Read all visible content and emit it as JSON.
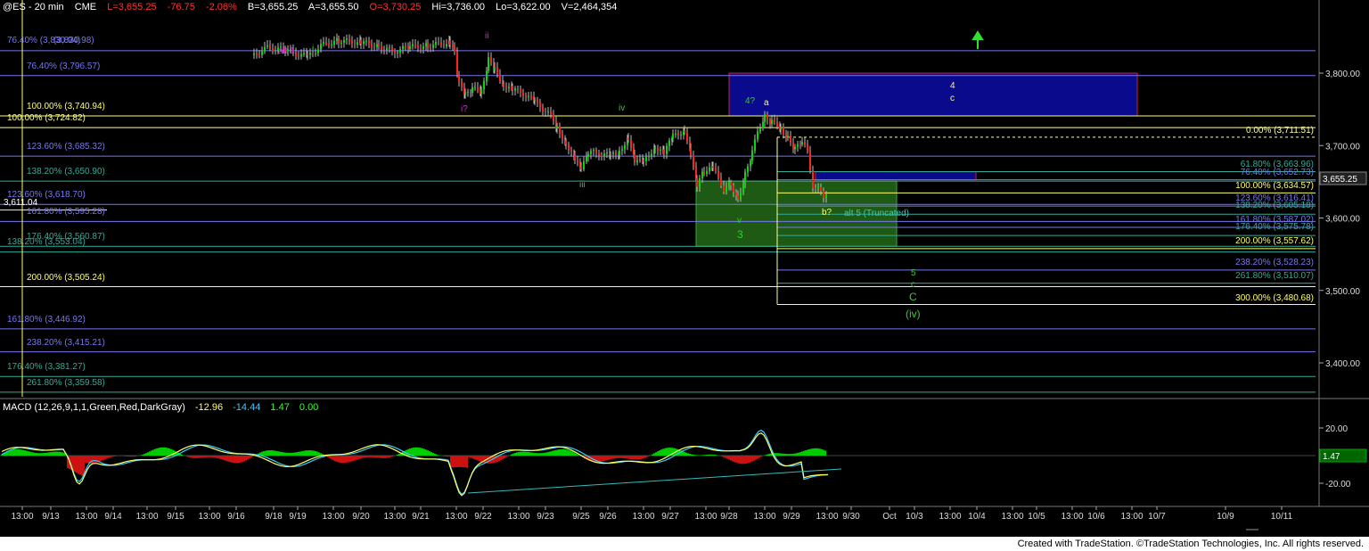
{
  "header": {
    "symbol": "@ES - 20 min",
    "exchange": "CME",
    "last": "L=3,655.25",
    "change": "-76.75",
    "change_pct": "-2.06%",
    "bid": "B=3,655.25",
    "ask": "A=3,655.50",
    "open": "O=3,730.25",
    "high": "Hi=3,736.00",
    "low": "Lo=3,622.00",
    "volume": "V=2,464,354"
  },
  "macd_header": {
    "title": "MACD (12,26,9,1,1,Green,Red,DarkGray)",
    "v1": "-12.96",
    "v2": "-14.44",
    "v3": "1.47",
    "v4": "0.00"
  },
  "footer": {
    "text": "Created with TradeStation. ©TradeStation Technologies, Inc. All rights reserved."
  },
  "colors": {
    "background": "#000000",
    "up": "#00ff00",
    "down": "#ff0000",
    "blue_box": "#0a0a8c",
    "green_box": "#1e5a14",
    "yellow": "#ffff66",
    "magenta": "#cc33cc"
  },
  "chart_data": {
    "type": "candlestick",
    "title": "@ES - 20 min",
    "price_axis": {
      "ticks": [
        "3,800.00",
        "3,700.00",
        "3,600.00",
        "3,500.00",
        "3,400.00"
      ],
      "current_price": "3,655.25"
    },
    "time_axis": {
      "ticks": [
        "13:00",
        "9/13",
        "13:00",
        "9/14",
        "13:00",
        "9/15",
        "13:00",
        "9/16",
        "9/18",
        "9/19",
        "13:00",
        "9/20",
        "13:00",
        "9/21",
        "13:00",
        "9/22",
        "13:00",
        "9/23",
        "9/25",
        "9/26",
        "13:00",
        "9/27",
        "13:00",
        "9/28",
        "13:00",
        "9/29",
        "13:00",
        "9/30",
        "Oct",
        "10/3",
        "13:00",
        "10/4",
        "13:00",
        "10/5",
        "13:00",
        "10/6",
        "13:00",
        "10/7",
        "10/9",
        "10/11"
      ]
    },
    "left_levels": [
      {
        "text": "76.40% (3,830.94)",
        "color": "#7777ee"
      },
      {
        "text": "(3,830.98)",
        "color": "#7777ee"
      },
      {
        "text": "76.40% (3,796.57)",
        "color": "#7777ee"
      },
      {
        "text": "100.00% (3,740.94)",
        "color": "#ffff66"
      },
      {
        "text": "100.00% (3,724.82)",
        "color": "#ffff99"
      },
      {
        "text": "123.60% (3,685.32)",
        "color": "#7777ee"
      },
      {
        "text": "138.20% (3,650.90)",
        "color": "#33aa99"
      },
      {
        "text": "123.60% (3,618.70)",
        "color": "#7777ee"
      },
      {
        "text": "3,611.04",
        "color": "#ffffff"
      },
      {
        "text": "161.80% (3,595.28)",
        "color": "#7777ee"
      },
      {
        "text": "176.40% (3,560.87)",
        "color": "#33aa99"
      },
      {
        "text": "138.20% (3,553.04)",
        "color": "#33aa99"
      },
      {
        "text": "200.00% (3,505.24)",
        "color": "#ffff66"
      },
      {
        "text": "161.80% (3,446.92)",
        "color": "#7777ee"
      },
      {
        "text": "238.20% (3,415.21)",
        "color": "#7777ee"
      },
      {
        "text": "176.40% (3,381.27)",
        "color": "#33aa99"
      },
      {
        "text": "261.80% (3,359.58)",
        "color": "#33aa99"
      }
    ],
    "right_levels": [
      {
        "text": "0.00% (3,711.51)",
        "color": "#ffff99"
      },
      {
        "text": "61.80% (3,663.96)",
        "color": "#33aa99"
      },
      {
        "text": "76.40% (3,652.73)",
        "color": "#7777ee"
      },
      {
        "text": "100.00% (3,634.57)",
        "color": "#ffff66"
      },
      {
        "text": "123.60% (3,616.41)",
        "color": "#7777ee"
      },
      {
        "text": "138.20% (3,605.18)",
        "color": "#33aa99"
      },
      {
        "text": "161.80% (3,587.02)",
        "color": "#7777ee"
      },
      {
        "text": "176.40% (3,575.78)",
        "color": "#33aa99"
      },
      {
        "text": "200.00% (3,557.62)",
        "color": "#ffff66"
      },
      {
        "text": "238.20% (3,528.23)",
        "color": "#7777ee"
      },
      {
        "text": "261.80% (3,510.07)",
        "color": "#33aa99"
      },
      {
        "text": "300.00% (3,480.68)",
        "color": "#ffff66"
      }
    ],
    "wave_labels": [
      {
        "text": "alt 1",
        "color": "#cc33cc"
      },
      {
        "text": "i",
        "color": "#33cc33"
      },
      {
        "text": "ii",
        "color": "#cc33cc"
      },
      {
        "text": "i?",
        "color": "#cc33cc"
      },
      {
        "text": "iv",
        "color": "#33cc33"
      },
      {
        "text": "iii",
        "color": "#33cc33"
      },
      {
        "text": "v",
        "color": "#33cc33"
      },
      {
        "text": "3",
        "color": "#33cc33"
      },
      {
        "text": "4?",
        "color": "#33cc33"
      },
      {
        "text": "a",
        "color": "#ffff66"
      },
      {
        "text": "b?",
        "color": "#ffff66"
      },
      {
        "text": "alt 5 (Truncated)",
        "color": "#33ccbb"
      },
      {
        "text": "4",
        "color": "#ffff66"
      },
      {
        "text": "c",
        "color": "#ffff66"
      },
      {
        "text": "5",
        "color": "#33cc33"
      },
      {
        "text": "c",
        "color": "#33cc33"
      },
      {
        "text": "C",
        "color": "#33cc33"
      },
      {
        "text": "(iv)",
        "color": "#33cc33"
      }
    ],
    "macd": {
      "ticks": [
        "20.00",
        "-20.00"
      ],
      "current": "1.47"
    }
  }
}
